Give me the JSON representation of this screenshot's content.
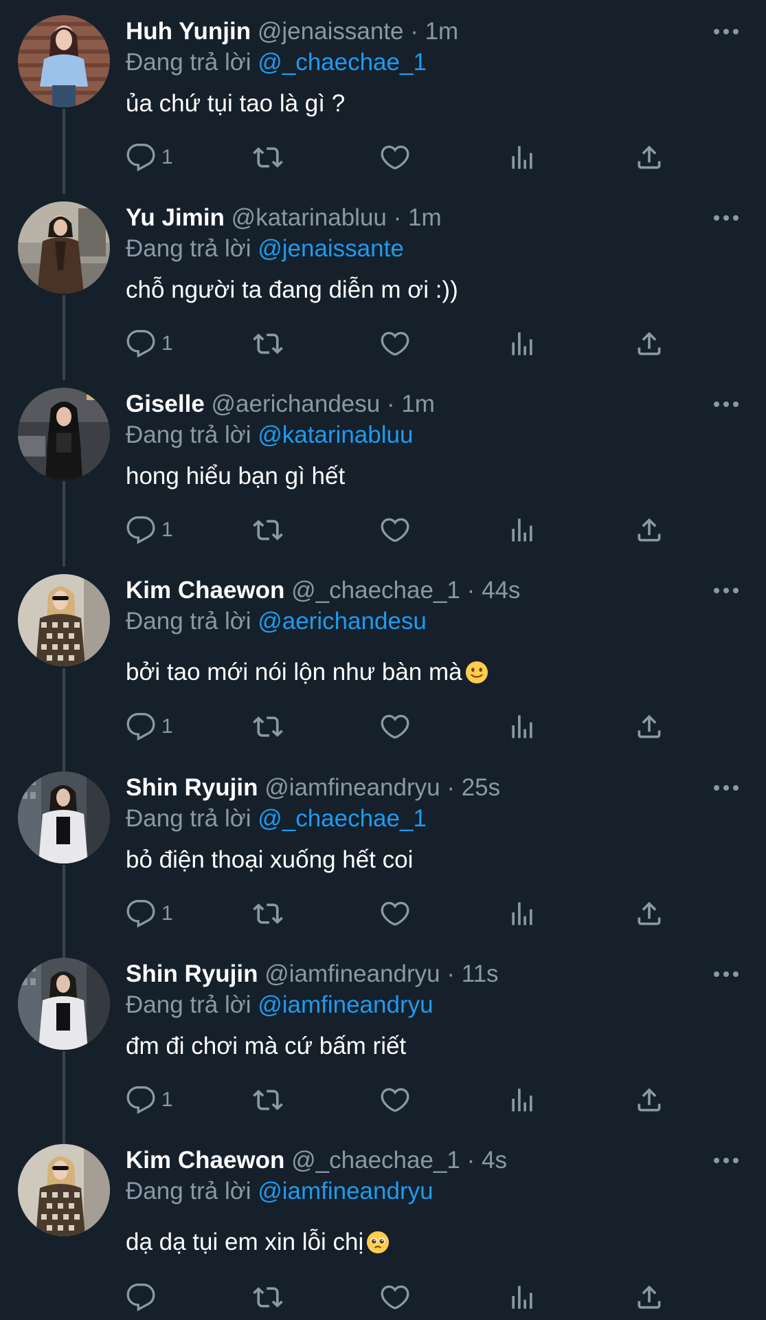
{
  "reply_prefix": "Đang trả lời",
  "colors": {
    "background": "#15202b",
    "text": "#ffffff",
    "muted": "#8b98a5",
    "link": "#1d9bf0",
    "thread_line": "#38444d"
  },
  "icons": {
    "reply": "reply-icon",
    "retweet": "retweet-icon",
    "like": "like-icon",
    "views": "views-icon",
    "share": "share-icon",
    "more": "more-icon"
  },
  "tweets": [
    {
      "name": "Huh Yunjin",
      "handle": "@jenaissante",
      "sep": " · ",
      "time": "1m",
      "reply_to": "@_chaechae_1",
      "text": "ủa chứ tụi tao là gì ?",
      "reply_count": "1"
    },
    {
      "name": "Yu Jimin",
      "handle": "@katarinabluu",
      "sep": " · ",
      "time": "1m",
      "reply_to": "@jenaissante",
      "text": "chỗ người ta đang diễn m ơi :))",
      "reply_count": "1"
    },
    {
      "name": "Giselle",
      "handle": "@aerichandesu",
      "sep": " · ",
      "time": "1m",
      "reply_to": "@katarinabluu",
      "text": "hong hiểu bạn gì hết",
      "reply_count": "1"
    },
    {
      "name": "Kim Chaewon",
      "handle": "@_chaechae_1",
      "sep": " · ",
      "time": "44s",
      "reply_to": "@aerichandesu",
      "text": "bởi tao mới nói lộn như bàn mà",
      "emoji": "slightly-smiling-face",
      "reply_count": "1"
    },
    {
      "name": "Shin Ryujin",
      "handle": "@iamfineandryu",
      "sep": " · ",
      "time": "25s",
      "reply_to": "@_chaechae_1",
      "text": "bỏ điện thoại xuống hết coi",
      "reply_count": "1"
    },
    {
      "name": "Shin Ryujin",
      "handle": "@iamfineandryu",
      "sep": " · ",
      "time": "11s",
      "reply_to": "@iamfineandryu",
      "text": "đm đi chơi mà cứ bấm riết",
      "reply_count": "1"
    },
    {
      "name": "Kim Chaewon",
      "handle": "@_chaechae_1",
      "sep": " · ",
      "time": "4s",
      "reply_to": "@iamfineandryu",
      "text": "dạ dạ tụi em xin lỗi chị",
      "emoji": "pleading-face",
      "reply_count": ""
    }
  ]
}
